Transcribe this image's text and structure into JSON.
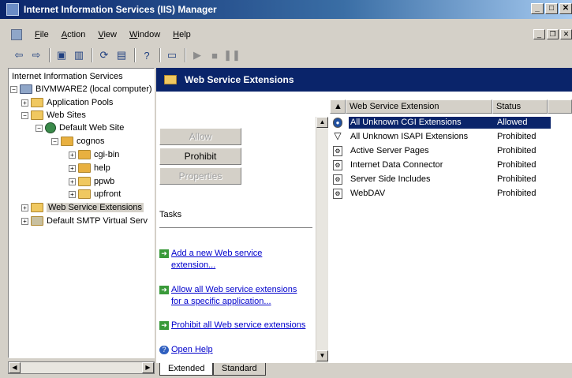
{
  "window": {
    "title": "Internet Information Services (IIS) Manager",
    "btn_min": "_",
    "btn_max": "□",
    "btn_close": "✕"
  },
  "menu": [
    "File",
    "Action",
    "View",
    "Window",
    "Help"
  ],
  "mdi": {
    "min": "_",
    "restore": "❐",
    "close": "✕"
  },
  "toolbar": [
    "back-icon",
    "forward-icon",
    "up-folder-icon",
    "show-hide-tree-icon",
    "refresh-icon",
    "export-list-icon",
    "help-icon",
    "computer-icon",
    "play-icon",
    "stop-icon",
    "pause-icon"
  ],
  "tree": {
    "root": "Internet Information Services",
    "server": "BIVMWARE2 (local computer)",
    "app_pools": "Application Pools",
    "web_sites": "Web Sites",
    "default_site": "Default Web Site",
    "cognos": "cognos",
    "cgi_bin": "cgi-bin",
    "help": "help",
    "ppwb": "ppwb",
    "upfront": "upfront",
    "wse": "Web Service Extensions",
    "smtp": "Default SMTP Virtual Serv"
  },
  "header": {
    "title": "Web Service Extensions"
  },
  "buttons": {
    "allow": "Allow",
    "prohibit": "Prohibit",
    "properties": "Properties"
  },
  "tasks": {
    "title": "Tasks",
    "add_l1": "Add a new Web service",
    "add_l2": "extension...",
    "allow_l1": "Allow all Web service extensions",
    "allow_l2": "for a specific application...",
    "prohibit": "Prohibit all Web service extensions",
    "help": "Open Help"
  },
  "list": {
    "columns": [
      "Web Service Extension",
      "Status"
    ],
    "rows": [
      {
        "name": "All Unknown CGI Extensions",
        "status": "Allowed",
        "icon": "globe-icon"
      },
      {
        "name": "All Unknown ISAPI Extensions",
        "status": "Prohibited",
        "icon": "filter-icon"
      },
      {
        "name": "Active Server Pages",
        "status": "Prohibited",
        "icon": "extension-icon"
      },
      {
        "name": "Internet Data Connector",
        "status": "Prohibited",
        "icon": "extension-icon"
      },
      {
        "name": "Server Side Includes",
        "status": "Prohibited",
        "icon": "extension-icon"
      },
      {
        "name": "WebDAV",
        "status": "Prohibited",
        "icon": "extension-icon"
      }
    ]
  },
  "view_tabs": [
    "Extended",
    "Standard"
  ],
  "colors": {
    "header_bg": "#0a246a",
    "link": "#0000cc",
    "selection": "#0a246a"
  }
}
